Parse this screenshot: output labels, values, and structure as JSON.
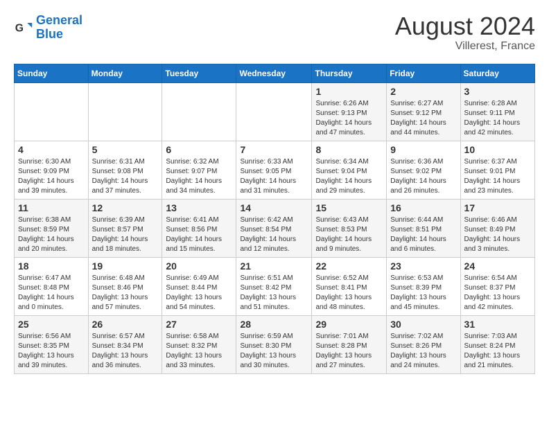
{
  "logo": {
    "line1": "General",
    "line2": "Blue"
  },
  "header": {
    "month": "August 2024",
    "location": "Villerest, France"
  },
  "weekdays": [
    "Sunday",
    "Monday",
    "Tuesday",
    "Wednesday",
    "Thursday",
    "Friday",
    "Saturday"
  ],
  "weeks": [
    [
      {
        "day": "",
        "info": ""
      },
      {
        "day": "",
        "info": ""
      },
      {
        "day": "",
        "info": ""
      },
      {
        "day": "",
        "info": ""
      },
      {
        "day": "1",
        "info": "Sunrise: 6:26 AM\nSunset: 9:13 PM\nDaylight: 14 hours and 47 minutes."
      },
      {
        "day": "2",
        "info": "Sunrise: 6:27 AM\nSunset: 9:12 PM\nDaylight: 14 hours and 44 minutes."
      },
      {
        "day": "3",
        "info": "Sunrise: 6:28 AM\nSunset: 9:11 PM\nDaylight: 14 hours and 42 minutes."
      }
    ],
    [
      {
        "day": "4",
        "info": "Sunrise: 6:30 AM\nSunset: 9:09 PM\nDaylight: 14 hours and 39 minutes."
      },
      {
        "day": "5",
        "info": "Sunrise: 6:31 AM\nSunset: 9:08 PM\nDaylight: 14 hours and 37 minutes."
      },
      {
        "day": "6",
        "info": "Sunrise: 6:32 AM\nSunset: 9:07 PM\nDaylight: 14 hours and 34 minutes."
      },
      {
        "day": "7",
        "info": "Sunrise: 6:33 AM\nSunset: 9:05 PM\nDaylight: 14 hours and 31 minutes."
      },
      {
        "day": "8",
        "info": "Sunrise: 6:34 AM\nSunset: 9:04 PM\nDaylight: 14 hours and 29 minutes."
      },
      {
        "day": "9",
        "info": "Sunrise: 6:36 AM\nSunset: 9:02 PM\nDaylight: 14 hours and 26 minutes."
      },
      {
        "day": "10",
        "info": "Sunrise: 6:37 AM\nSunset: 9:01 PM\nDaylight: 14 hours and 23 minutes."
      }
    ],
    [
      {
        "day": "11",
        "info": "Sunrise: 6:38 AM\nSunset: 8:59 PM\nDaylight: 14 hours and 20 minutes."
      },
      {
        "day": "12",
        "info": "Sunrise: 6:39 AM\nSunset: 8:57 PM\nDaylight: 14 hours and 18 minutes."
      },
      {
        "day": "13",
        "info": "Sunrise: 6:41 AM\nSunset: 8:56 PM\nDaylight: 14 hours and 15 minutes."
      },
      {
        "day": "14",
        "info": "Sunrise: 6:42 AM\nSunset: 8:54 PM\nDaylight: 14 hours and 12 minutes."
      },
      {
        "day": "15",
        "info": "Sunrise: 6:43 AM\nSunset: 8:53 PM\nDaylight: 14 hours and 9 minutes."
      },
      {
        "day": "16",
        "info": "Sunrise: 6:44 AM\nSunset: 8:51 PM\nDaylight: 14 hours and 6 minutes."
      },
      {
        "day": "17",
        "info": "Sunrise: 6:46 AM\nSunset: 8:49 PM\nDaylight: 14 hours and 3 minutes."
      }
    ],
    [
      {
        "day": "18",
        "info": "Sunrise: 6:47 AM\nSunset: 8:48 PM\nDaylight: 14 hours and 0 minutes."
      },
      {
        "day": "19",
        "info": "Sunrise: 6:48 AM\nSunset: 8:46 PM\nDaylight: 13 hours and 57 minutes."
      },
      {
        "day": "20",
        "info": "Sunrise: 6:49 AM\nSunset: 8:44 PM\nDaylight: 13 hours and 54 minutes."
      },
      {
        "day": "21",
        "info": "Sunrise: 6:51 AM\nSunset: 8:42 PM\nDaylight: 13 hours and 51 minutes."
      },
      {
        "day": "22",
        "info": "Sunrise: 6:52 AM\nSunset: 8:41 PM\nDaylight: 13 hours and 48 minutes."
      },
      {
        "day": "23",
        "info": "Sunrise: 6:53 AM\nSunset: 8:39 PM\nDaylight: 13 hours and 45 minutes."
      },
      {
        "day": "24",
        "info": "Sunrise: 6:54 AM\nSunset: 8:37 PM\nDaylight: 13 hours and 42 minutes."
      }
    ],
    [
      {
        "day": "25",
        "info": "Sunrise: 6:56 AM\nSunset: 8:35 PM\nDaylight: 13 hours and 39 minutes."
      },
      {
        "day": "26",
        "info": "Sunrise: 6:57 AM\nSunset: 8:34 PM\nDaylight: 13 hours and 36 minutes."
      },
      {
        "day": "27",
        "info": "Sunrise: 6:58 AM\nSunset: 8:32 PM\nDaylight: 13 hours and 33 minutes."
      },
      {
        "day": "28",
        "info": "Sunrise: 6:59 AM\nSunset: 8:30 PM\nDaylight: 13 hours and 30 minutes."
      },
      {
        "day": "29",
        "info": "Sunrise: 7:01 AM\nSunset: 8:28 PM\nDaylight: 13 hours and 27 minutes."
      },
      {
        "day": "30",
        "info": "Sunrise: 7:02 AM\nSunset: 8:26 PM\nDaylight: 13 hours and 24 minutes."
      },
      {
        "day": "31",
        "info": "Sunrise: 7:03 AM\nSunset: 8:24 PM\nDaylight: 13 hours and 21 minutes."
      }
    ]
  ]
}
